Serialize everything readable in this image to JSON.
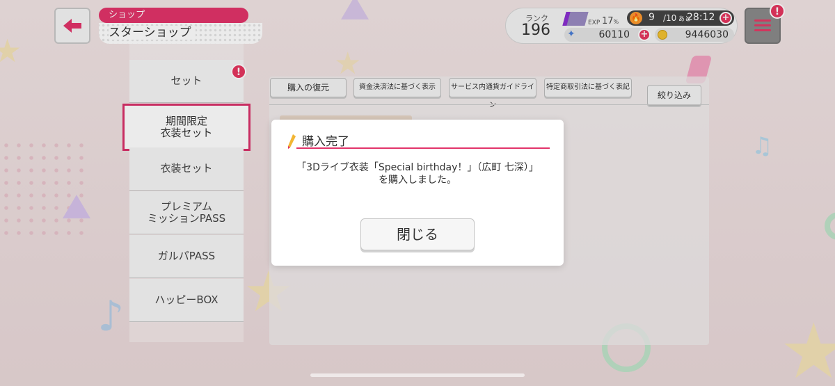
{
  "header": {
    "title_top": "ショップ",
    "title_main": "スターショップ"
  },
  "status": {
    "rank_label": "ランク",
    "rank_value": "196",
    "exp_label": "EXP",
    "exp_percent": "17",
    "exp_percent_unit": "%",
    "exp_fraction": 0.17,
    "stamina_current": "9",
    "stamina_max": "/10",
    "stamina_ato": "あと",
    "stamina_timer": "28:12",
    "gems": "60110",
    "coins": "9446030"
  },
  "sidebar": {
    "items": [
      {
        "label": "セット"
      },
      {
        "label": "期間限定\n衣装セット"
      },
      {
        "label": "衣装セット"
      },
      {
        "label": "プレミアム\nミッションPASS"
      },
      {
        "label": "ガルパPASS"
      },
      {
        "label": "ハッピーBOX"
      }
    ]
  },
  "toolbar": {
    "restore": "購入の復元",
    "fund_settlement": "資金決済法に基づく表示",
    "currency_guide": "サービス内通貨ガイドライン",
    "commerce_law": "特定商取引法に基づく表記",
    "filter": "絞り込み"
  },
  "dialog": {
    "title": "購入完了",
    "message": "「3Dライブ衣装「Special birthday！」（広町 七深）」\nを購入しました。",
    "close": "閉じる"
  },
  "colors": {
    "accent": "#e2336a",
    "alert": "#e5365f"
  }
}
